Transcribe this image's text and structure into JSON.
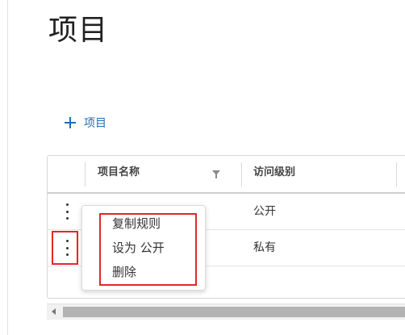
{
  "page": {
    "title": "项目",
    "add_button_label": "项目"
  },
  "table": {
    "columns": [
      {
        "label": ""
      },
      {
        "label": "项目名称"
      },
      {
        "label": "访问级别"
      }
    ],
    "rows": [
      {
        "name": "",
        "access_level": "公开"
      },
      {
        "name": "",
        "access_level": "私有"
      }
    ]
  },
  "context_menu": {
    "items": [
      {
        "label": "复制规则"
      },
      {
        "label": "设为 公开"
      },
      {
        "label": "删除"
      }
    ]
  },
  "colors": {
    "accent": "#1f6fb5",
    "highlight": "#e0262b"
  },
  "icons": [
    "plus-icon",
    "filter-icon",
    "more-vertical-icon",
    "scroll-left-arrow-icon"
  ]
}
